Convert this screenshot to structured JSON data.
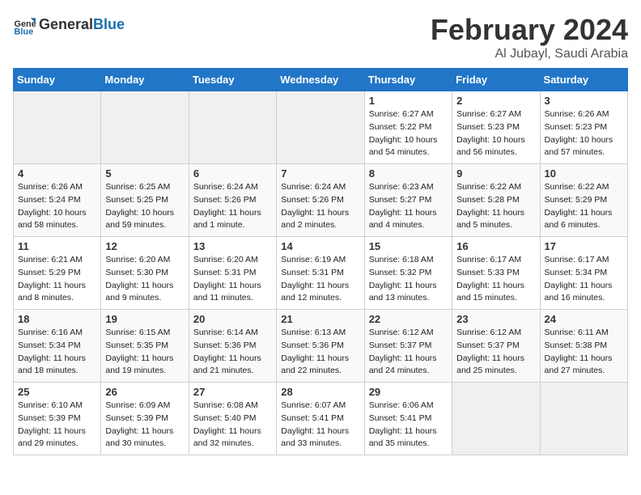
{
  "logo": {
    "general": "General",
    "blue": "Blue"
  },
  "header": {
    "month": "February 2024",
    "location": "Al Jubayl, Saudi Arabia"
  },
  "weekdays": [
    "Sunday",
    "Monday",
    "Tuesday",
    "Wednesday",
    "Thursday",
    "Friday",
    "Saturday"
  ],
  "weeks": [
    [
      {
        "day": null
      },
      {
        "day": null
      },
      {
        "day": null
      },
      {
        "day": null
      },
      {
        "day": 1,
        "sunrise": "6:27 AM",
        "sunset": "5:22 PM",
        "daylight": "10 hours and 54 minutes."
      },
      {
        "day": 2,
        "sunrise": "6:27 AM",
        "sunset": "5:23 PM",
        "daylight": "10 hours and 56 minutes."
      },
      {
        "day": 3,
        "sunrise": "6:26 AM",
        "sunset": "5:23 PM",
        "daylight": "10 hours and 57 minutes."
      }
    ],
    [
      {
        "day": 4,
        "sunrise": "6:26 AM",
        "sunset": "5:24 PM",
        "daylight": "10 hours and 58 minutes."
      },
      {
        "day": 5,
        "sunrise": "6:25 AM",
        "sunset": "5:25 PM",
        "daylight": "10 hours and 59 minutes."
      },
      {
        "day": 6,
        "sunrise": "6:24 AM",
        "sunset": "5:26 PM",
        "daylight": "11 hours and 1 minute."
      },
      {
        "day": 7,
        "sunrise": "6:24 AM",
        "sunset": "5:26 PM",
        "daylight": "11 hours and 2 minutes."
      },
      {
        "day": 8,
        "sunrise": "6:23 AM",
        "sunset": "5:27 PM",
        "daylight": "11 hours and 4 minutes."
      },
      {
        "day": 9,
        "sunrise": "6:22 AM",
        "sunset": "5:28 PM",
        "daylight": "11 hours and 5 minutes."
      },
      {
        "day": 10,
        "sunrise": "6:22 AM",
        "sunset": "5:29 PM",
        "daylight": "11 hours and 6 minutes."
      }
    ],
    [
      {
        "day": 11,
        "sunrise": "6:21 AM",
        "sunset": "5:29 PM",
        "daylight": "11 hours and 8 minutes."
      },
      {
        "day": 12,
        "sunrise": "6:20 AM",
        "sunset": "5:30 PM",
        "daylight": "11 hours and 9 minutes."
      },
      {
        "day": 13,
        "sunrise": "6:20 AM",
        "sunset": "5:31 PM",
        "daylight": "11 hours and 11 minutes."
      },
      {
        "day": 14,
        "sunrise": "6:19 AM",
        "sunset": "5:31 PM",
        "daylight": "11 hours and 12 minutes."
      },
      {
        "day": 15,
        "sunrise": "6:18 AM",
        "sunset": "5:32 PM",
        "daylight": "11 hours and 13 minutes."
      },
      {
        "day": 16,
        "sunrise": "6:17 AM",
        "sunset": "5:33 PM",
        "daylight": "11 hours and 15 minutes."
      },
      {
        "day": 17,
        "sunrise": "6:17 AM",
        "sunset": "5:34 PM",
        "daylight": "11 hours and 16 minutes."
      }
    ],
    [
      {
        "day": 18,
        "sunrise": "6:16 AM",
        "sunset": "5:34 PM",
        "daylight": "11 hours and 18 minutes."
      },
      {
        "day": 19,
        "sunrise": "6:15 AM",
        "sunset": "5:35 PM",
        "daylight": "11 hours and 19 minutes."
      },
      {
        "day": 20,
        "sunrise": "6:14 AM",
        "sunset": "5:36 PM",
        "daylight": "11 hours and 21 minutes."
      },
      {
        "day": 21,
        "sunrise": "6:13 AM",
        "sunset": "5:36 PM",
        "daylight": "11 hours and 22 minutes."
      },
      {
        "day": 22,
        "sunrise": "6:12 AM",
        "sunset": "5:37 PM",
        "daylight": "11 hours and 24 minutes."
      },
      {
        "day": 23,
        "sunrise": "6:12 AM",
        "sunset": "5:37 PM",
        "daylight": "11 hours and 25 minutes."
      },
      {
        "day": 24,
        "sunrise": "6:11 AM",
        "sunset": "5:38 PM",
        "daylight": "11 hours and 27 minutes."
      }
    ],
    [
      {
        "day": 25,
        "sunrise": "6:10 AM",
        "sunset": "5:39 PM",
        "daylight": "11 hours and 29 minutes."
      },
      {
        "day": 26,
        "sunrise": "6:09 AM",
        "sunset": "5:39 PM",
        "daylight": "11 hours and 30 minutes."
      },
      {
        "day": 27,
        "sunrise": "6:08 AM",
        "sunset": "5:40 PM",
        "daylight": "11 hours and 32 minutes."
      },
      {
        "day": 28,
        "sunrise": "6:07 AM",
        "sunset": "5:41 PM",
        "daylight": "11 hours and 33 minutes."
      },
      {
        "day": 29,
        "sunrise": "6:06 AM",
        "sunset": "5:41 PM",
        "daylight": "11 hours and 35 minutes."
      },
      {
        "day": null
      },
      {
        "day": null
      }
    ]
  ],
  "labels": {
    "sunrise_prefix": "Sunrise: ",
    "sunset_prefix": "Sunset: ",
    "daylight_prefix": "Daylight: "
  }
}
